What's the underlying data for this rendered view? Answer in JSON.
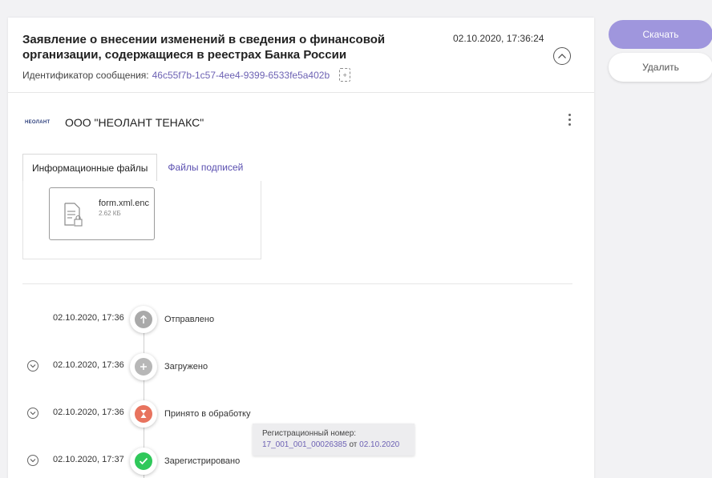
{
  "header": {
    "title": "Заявление о внесении изменений в сведения о финансовой организации, содержащиеся в реестрах Банка России",
    "datetime": "02.10.2020, 17:36:24",
    "message_id_label": "Идентификатор сообщения:",
    "message_id_value": "46c55f7b-1c57-4ee4-9399-6533fe5a402b"
  },
  "organization": {
    "logo_text": "НЕОЛАНТ",
    "name": "ООО \"НЕОЛАНТ ТЕНАКС\""
  },
  "tabs": [
    {
      "label": "Информационные файлы",
      "active": true
    },
    {
      "label": "Файлы подписей",
      "active": false
    }
  ],
  "files": [
    {
      "name": "form.xml.enc",
      "size": "2.62 КБ"
    }
  ],
  "timeline": [
    {
      "time": "02.10.2020, 17:36",
      "status": "Отправлено",
      "color": "#a9a9a9",
      "icon": "arrow-up-icon",
      "expandable": false
    },
    {
      "time": "02.10.2020, 17:36",
      "status": "Загружено",
      "color": "#b7b7b7",
      "icon": "plus-icon",
      "expandable": true
    },
    {
      "time": "02.10.2020, 17:36",
      "status": "Принято в обработку",
      "color": "#e8735e",
      "icon": "hourglass-icon",
      "expandable": true
    },
    {
      "time": "02.10.2020, 17:37",
      "status": "Зарегистрировано",
      "color": "#2fc85a",
      "icon": "check-icon",
      "expandable": true
    }
  ],
  "tooltip": {
    "label": "Регистрационный номер:",
    "number": "17_001_001_00026385",
    "from": "от",
    "date": "02.10.2020"
  },
  "actions": {
    "download": "Скачать",
    "delete": "Удалить"
  },
  "colors": {
    "accent": "#9f96dd",
    "link": "#6d62b4"
  }
}
